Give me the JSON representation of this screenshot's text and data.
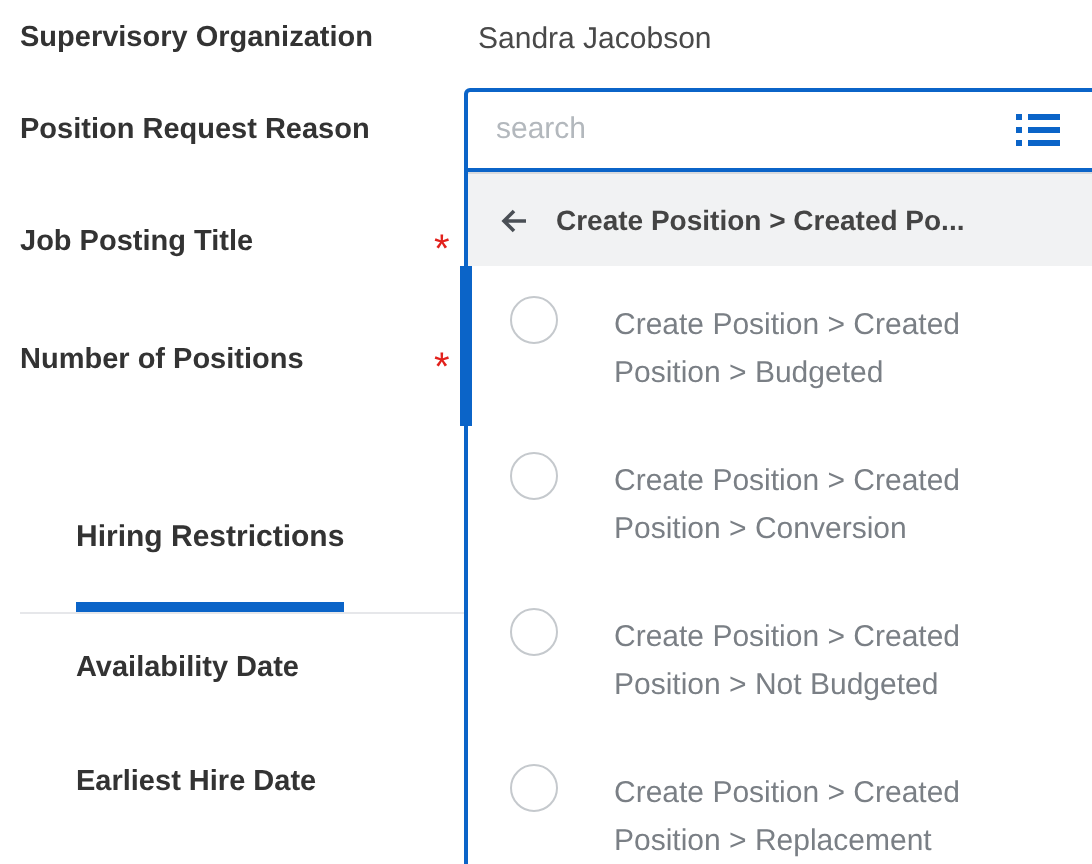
{
  "fields": [
    {
      "label": "Supervisory Organization",
      "value": "Sandra Jacobson"
    },
    {
      "label": "Position Request Reason"
    },
    {
      "label": "Job Posting Title",
      "required_mark": "*"
    },
    {
      "label": "Number of Positions",
      "required_mark": "*"
    }
  ],
  "tabs": [
    {
      "label": "Hiring Restrictions",
      "selected": true
    }
  ],
  "tab_fields": [
    {
      "label": "Availability Date"
    },
    {
      "label": "Earliest Hire Date"
    }
  ],
  "dropdown": {
    "search": {
      "placeholder": "search"
    },
    "breadcrumb": "Create Position > Created Po...",
    "options": [
      {
        "label": "Create Position > Created Position > Budgeted",
        "selected": false
      },
      {
        "label": "Create Position > Created Position > Conversion",
        "selected": false
      },
      {
        "label": "Create Position > Created Position > Not Budgeted",
        "selected": false
      },
      {
        "label": "Create Position > Created Position > Replacement",
        "selected": false
      }
    ]
  }
}
